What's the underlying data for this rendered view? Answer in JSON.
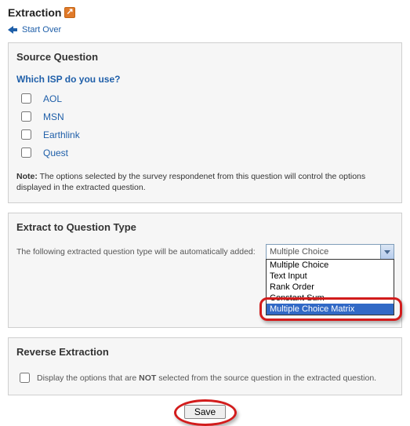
{
  "header": {
    "title": "Extraction",
    "start_over": "Start Over"
  },
  "source": {
    "panel_title": "Source Question",
    "question": "Which ISP do you use?",
    "options": [
      "AOL",
      "MSN",
      "Earthlink",
      "Quest"
    ],
    "note_label": "Note:",
    "note_text": " The options selected by the survey respondenet from this question will control the options displayed in the extracted question."
  },
  "extract": {
    "panel_title": "Extract to Question Type",
    "label": "The following extracted question type will be automatically added:",
    "selected": "Multiple Choice",
    "options": [
      "Multiple Choice",
      "Text Input",
      "Rank Order",
      "Constant Sum",
      "Multiple Choice Matrix"
    ],
    "highlighted_index": 4
  },
  "reverse": {
    "panel_title": "Reverse Extraction",
    "text_before": "Display the options that are ",
    "text_bold": "NOT",
    "text_after": " selected from the source question in the extracted question."
  },
  "footer": {
    "save": "Save"
  }
}
